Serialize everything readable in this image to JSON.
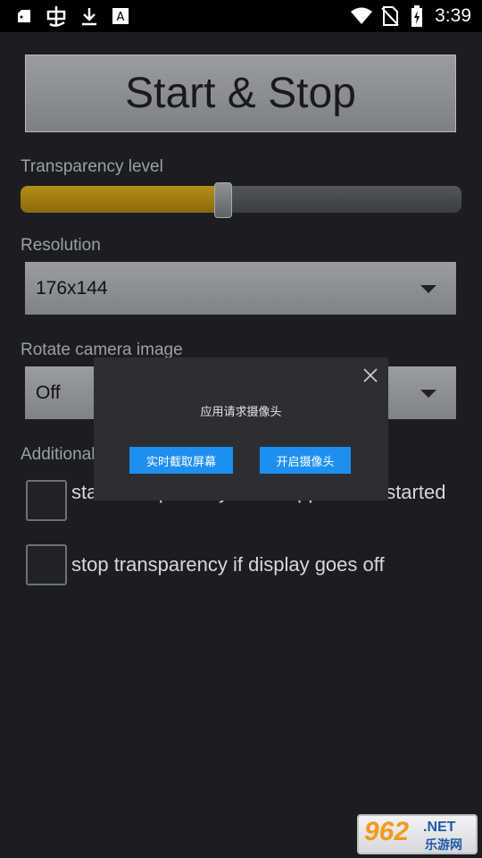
{
  "status_bar": {
    "time": "3:39",
    "icons": [
      "android-debug-icon",
      "bug-icon",
      "download-icon",
      "font-icon",
      "wifi-icon",
      "no-sim-icon",
      "battery-charging-icon"
    ]
  },
  "main": {
    "start_stop_label": "Start & Stop",
    "transparency_label": "Transparency level",
    "transparency_value": 0.46,
    "resolution_label": "Resolution",
    "resolution_value": "176x144",
    "rotate_label": "Rotate camera image",
    "rotate_value": "Off",
    "additional_label": "Additional",
    "checkbox1_label": "start transparency when application started",
    "checkbox2_label": "stop transparency if display goes off"
  },
  "dialog": {
    "message": "应用请求摄像头",
    "button_screen_capture": "实时截取屏幕",
    "button_open_camera": "开启摄像头"
  },
  "watermark": {
    "number": "962",
    "net": ".NET",
    "chinese": "乐游网"
  },
  "colors": {
    "background": "#1c1d21",
    "slider_fill": "#b58e17",
    "dialog_button": "#1d8ff0"
  }
}
